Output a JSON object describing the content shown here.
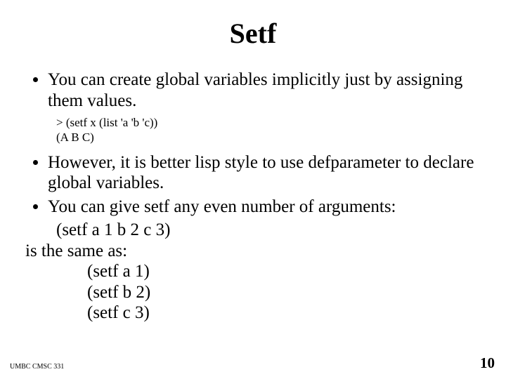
{
  "title": "Setf",
  "bullets": {
    "b1": "You can create global variables implicitly just by assigning them values.",
    "code1_l1": "> (setf   x   (list  'a  'b  'c))",
    "code1_l2": " (A B C)",
    "b2": "However,  it is better lisp style  to use defparameter to declare global variables.",
    "b3": "You can give setf any even number of arguments:",
    "ex1": "(setf  a   1 b   2 c   3)",
    "same_as": "is the same as:",
    "ex2a": "(setf a 1)",
    "ex2b": "(setf b 2)",
    "ex2c": "(setf c 3)"
  },
  "footer": {
    "left": "UMBC CMSC 331",
    "right": "10"
  }
}
